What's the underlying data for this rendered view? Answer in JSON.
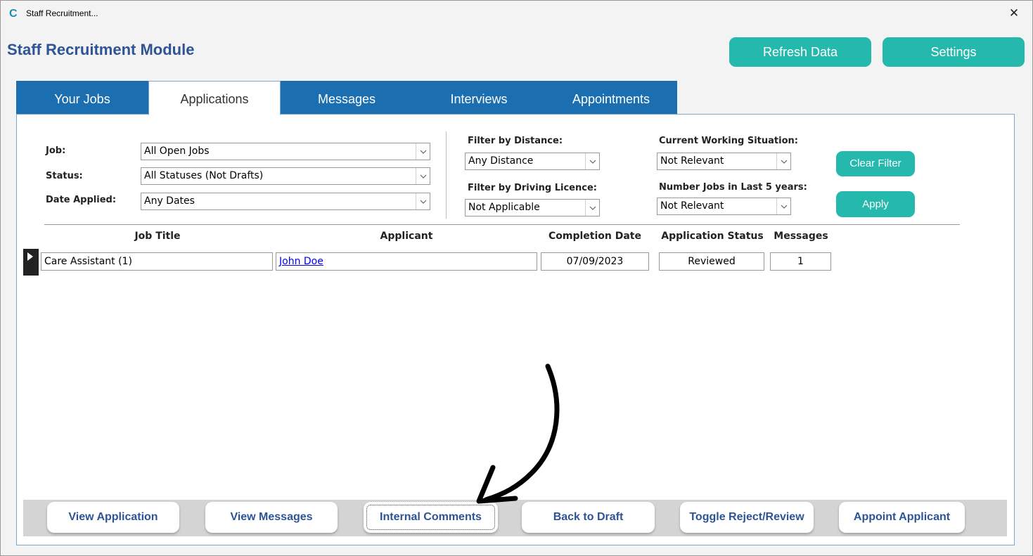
{
  "window": {
    "title": "Staff Recruitment...",
    "close_symbol": "✕",
    "logo_letter": "C"
  },
  "header": {
    "module_title": "Staff Recruitment Module",
    "refresh_label": "Refresh Data",
    "settings_label": "Settings"
  },
  "tabs": [
    {
      "label": "Your Jobs",
      "active": false
    },
    {
      "label": "Applications",
      "active": true
    },
    {
      "label": "Messages",
      "active": false
    },
    {
      "label": "Interviews",
      "active": false
    },
    {
      "label": "Appointments",
      "active": false
    }
  ],
  "filters": {
    "job": {
      "label": "Job:",
      "value": "All Open Jobs"
    },
    "status": {
      "label": "Status:",
      "value": "All Statuses (Not Drafts)"
    },
    "date_applied": {
      "label": "Date Applied:",
      "value": "Any Dates"
    },
    "distance": {
      "label": "Filter by Distance:",
      "value": "Any Distance"
    },
    "driving_licence": {
      "label": "Filter by Driving Licence:",
      "value": "Not Applicable"
    },
    "working_situation": {
      "label": "Current Working Situation:",
      "value": "Not Relevant"
    },
    "jobs_last_5": {
      "label": "Number Jobs in Last 5 years:",
      "value": "Not Relevant"
    },
    "clear_label": "Clear Filter",
    "apply_label": "Apply"
  },
  "table": {
    "columns": [
      "Job Title",
      "Applicant",
      "Completion Date",
      "Application Status",
      "Messages"
    ],
    "rows": [
      {
        "job_title": "Care Assistant (1)",
        "applicant": "John Doe",
        "completion_date": "07/09/2023",
        "status": "Reviewed",
        "messages": "1"
      }
    ]
  },
  "actions": {
    "view_application": "View Application",
    "view_messages": "View Messages",
    "internal_comments": "Internal Comments",
    "back_to_draft": "Back to Draft",
    "toggle_reject_review": "Toggle Reject/Review",
    "appoint_applicant": "Appoint Applicant"
  },
  "colors": {
    "accent_teal": "#25b9ad",
    "tab_blue": "#1b6fb0",
    "title_blue": "#2f5496"
  },
  "annotation": {
    "icon": "curved-arrow-icon",
    "points_to": "internal-comments-button"
  }
}
